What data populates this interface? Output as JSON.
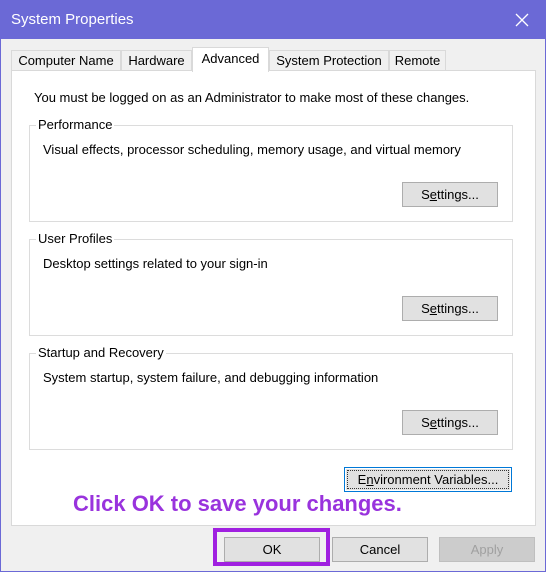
{
  "window": {
    "title": "System Properties"
  },
  "tabs": [
    {
      "label": "Computer Name"
    },
    {
      "label": "Hardware"
    },
    {
      "label": "Advanced"
    },
    {
      "label": "System Protection"
    },
    {
      "label": "Remote"
    }
  ],
  "active_tab": "Advanced",
  "panel": {
    "admin_note": "You must be logged on as an Administrator to make most of these changes.",
    "groups": [
      {
        "label": "Performance",
        "description": "Visual effects, processor scheduling, memory usage, and virtual memory",
        "button_prefix": "S",
        "button_ul": "e",
        "button_rest": "ttings..."
      },
      {
        "label": "User Profiles",
        "description": "Desktop settings related to your sign-in",
        "button_prefix": "S",
        "button_ul": "e",
        "button_rest": "ttings..."
      },
      {
        "label": "Startup and Recovery",
        "description": "System startup, system failure, and debugging information",
        "button_prefix": "S",
        "button_ul": "e",
        "button_rest": "ttings..."
      }
    ],
    "env_button": {
      "prefix": "E",
      "ul": "n",
      "rest": "vironment Variables..."
    }
  },
  "annotation": "Click OK to save your changes.",
  "footer": {
    "ok_label": "OK",
    "cancel_label": "Cancel",
    "apply_label": "Apply"
  },
  "colors": {
    "titlebar": "#6b69d6",
    "annotation": "#9933dd",
    "highlight": "#a020e0"
  },
  "icons": {
    "close": "close-icon"
  }
}
